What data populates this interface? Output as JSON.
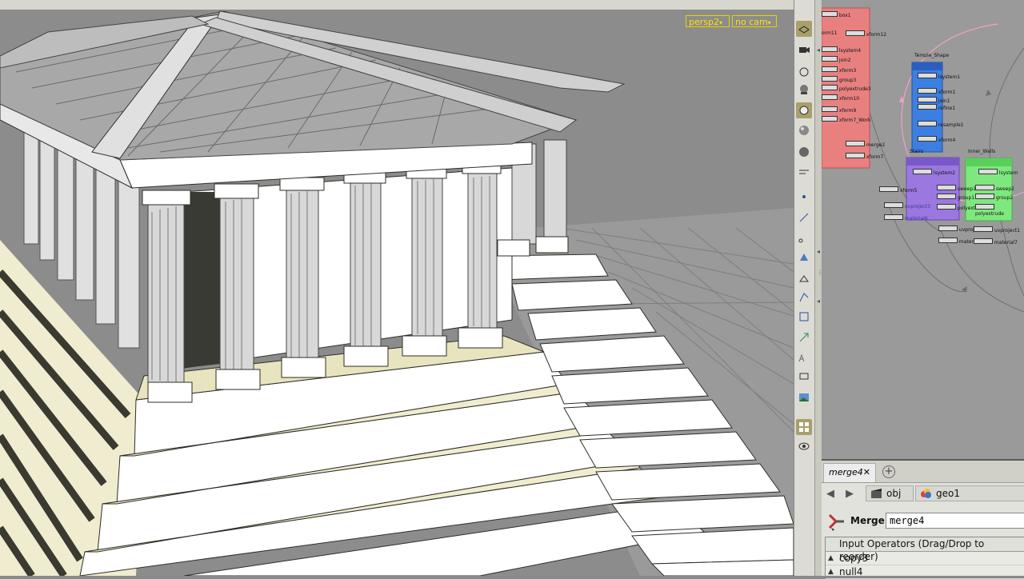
{
  "viewport": {
    "view_menu": "persp2",
    "camera_menu": "no cam"
  },
  "network": {
    "nodes": [
      {
        "label": "box1"
      },
      {
        "label": "orm11"
      },
      {
        "label": "xform12"
      },
      {
        "label": "lsystem4"
      },
      {
        "label": "join2"
      },
      {
        "label": "xform3"
      },
      {
        "label": "group3"
      },
      {
        "label": "polyextrude3"
      },
      {
        "label": "xform10"
      },
      {
        "label": "xform9"
      },
      {
        "label": "xform7_Work"
      },
      {
        "label": "merge2"
      },
      {
        "label": "xform7"
      },
      {
        "label": "Temple_Shape"
      },
      {
        "label": "lsystem1"
      },
      {
        "label": "xform1"
      },
      {
        "label": "join1"
      },
      {
        "label": "refine1"
      },
      {
        "label": "resample1"
      },
      {
        "label": "xform4"
      },
      {
        "label": "Stairs"
      },
      {
        "label": "Inner_Walls"
      },
      {
        "label": "lsystem2"
      },
      {
        "label": "lsystem"
      },
      {
        "label": "xform5"
      },
      {
        "label": "sweep1"
      },
      {
        "label": "sweep2"
      },
      {
        "label": "group1"
      },
      {
        "label": "group2"
      },
      {
        "label": "uvproject3"
      },
      {
        "label": "polyextrude1"
      },
      {
        "label": "polyextrude"
      },
      {
        "label": "material6"
      },
      {
        "label": "uvproject"
      },
      {
        "label": "uvproject1"
      },
      {
        "label": "material"
      },
      {
        "label": "material7"
      }
    ]
  },
  "params": {
    "tab_label": "merge4",
    "tab_close": "✕",
    "tab_add": "+",
    "nav_back": "◀",
    "nav_forward": "▶",
    "path": [
      "obj",
      "geo1"
    ],
    "op_type": "Merge",
    "op_name": "merge4",
    "inputs_header": "Input Operators (Drag/Drop to reorder)",
    "inputs": [
      "copy3",
      "null4"
    ],
    "input_arrow": "▲"
  },
  "colors": {
    "viewport_bg": "#8c8c8c",
    "yellow_menu": "#ffe100",
    "red_network_box": "#e88080",
    "blue_network_box": "#3d7fe0",
    "purple_network_box": "#9a78e0",
    "green_network_box": "#7ee87e"
  }
}
